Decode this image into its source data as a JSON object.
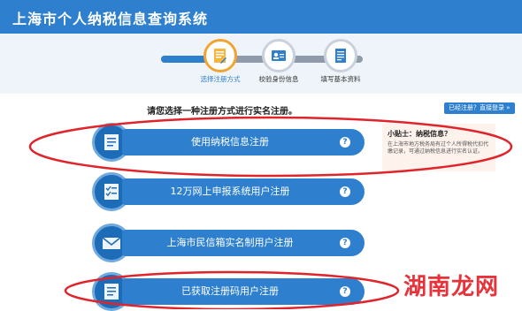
{
  "header": {
    "title": "上海市个人纳税信息查询系统"
  },
  "steps": [
    {
      "label": "选择注册方式",
      "icon": "document-icon"
    },
    {
      "label": "校验身份信息",
      "icon": "id-card-icon"
    },
    {
      "label": "填写基本资料",
      "icon": "form-icon"
    }
  ],
  "prompt": "请您选择一种注册方式进行实名注册。",
  "login_link": "已经注册？直接登录 »",
  "options": [
    {
      "label": "使用纳税信息注册",
      "help": "?",
      "icon": "document-icon"
    },
    {
      "label": "12万网上申报系统用户注册",
      "help": "?",
      "icon": "checklist-icon"
    },
    {
      "label": "上海市民信箱实名制用户注册",
      "help": "?",
      "icon": "envelope-icon"
    },
    {
      "label": "已获取注册码用户注册",
      "help": "?",
      "icon": "document-icon"
    }
  ],
  "tip": {
    "title": "小贴士：纳税信息？",
    "text": "在上海市地方税务局有过个人所得税代扣代缴记录，可通过纳税信息进行实名认证。"
  },
  "watermark": "湖南龙网",
  "colors": {
    "header": "#2e80cf",
    "accent": "#f1a530",
    "annotation": "#e0242b"
  }
}
